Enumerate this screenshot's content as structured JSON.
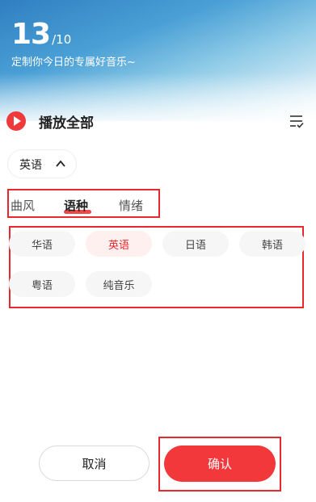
{
  "header": {
    "day": "13",
    "month": "/10",
    "subtitle": "定制你今日的专属好音乐~"
  },
  "play_all": {
    "label": "播放全部",
    "icon": "play-circle-icon",
    "list_icon": "list-check-icon"
  },
  "filter": {
    "current_label": "英语",
    "chevron_icon": "chevron-up-icon"
  },
  "tabs": [
    {
      "label": "曲风",
      "active": false
    },
    {
      "label": "语种",
      "active": true
    },
    {
      "label": "情绪",
      "active": false
    }
  ],
  "chips": [
    {
      "label": "华语",
      "selected": false
    },
    {
      "label": "英语",
      "selected": true
    },
    {
      "label": "日语",
      "selected": false
    },
    {
      "label": "韩语",
      "selected": false
    },
    {
      "label": "粤语",
      "selected": false
    },
    {
      "label": "纯音乐",
      "selected": false
    }
  ],
  "actions": {
    "cancel": "取消",
    "confirm": "确认"
  },
  "colors": {
    "accent": "#f3383b",
    "selected_chip_bg": "#fff0f0"
  }
}
